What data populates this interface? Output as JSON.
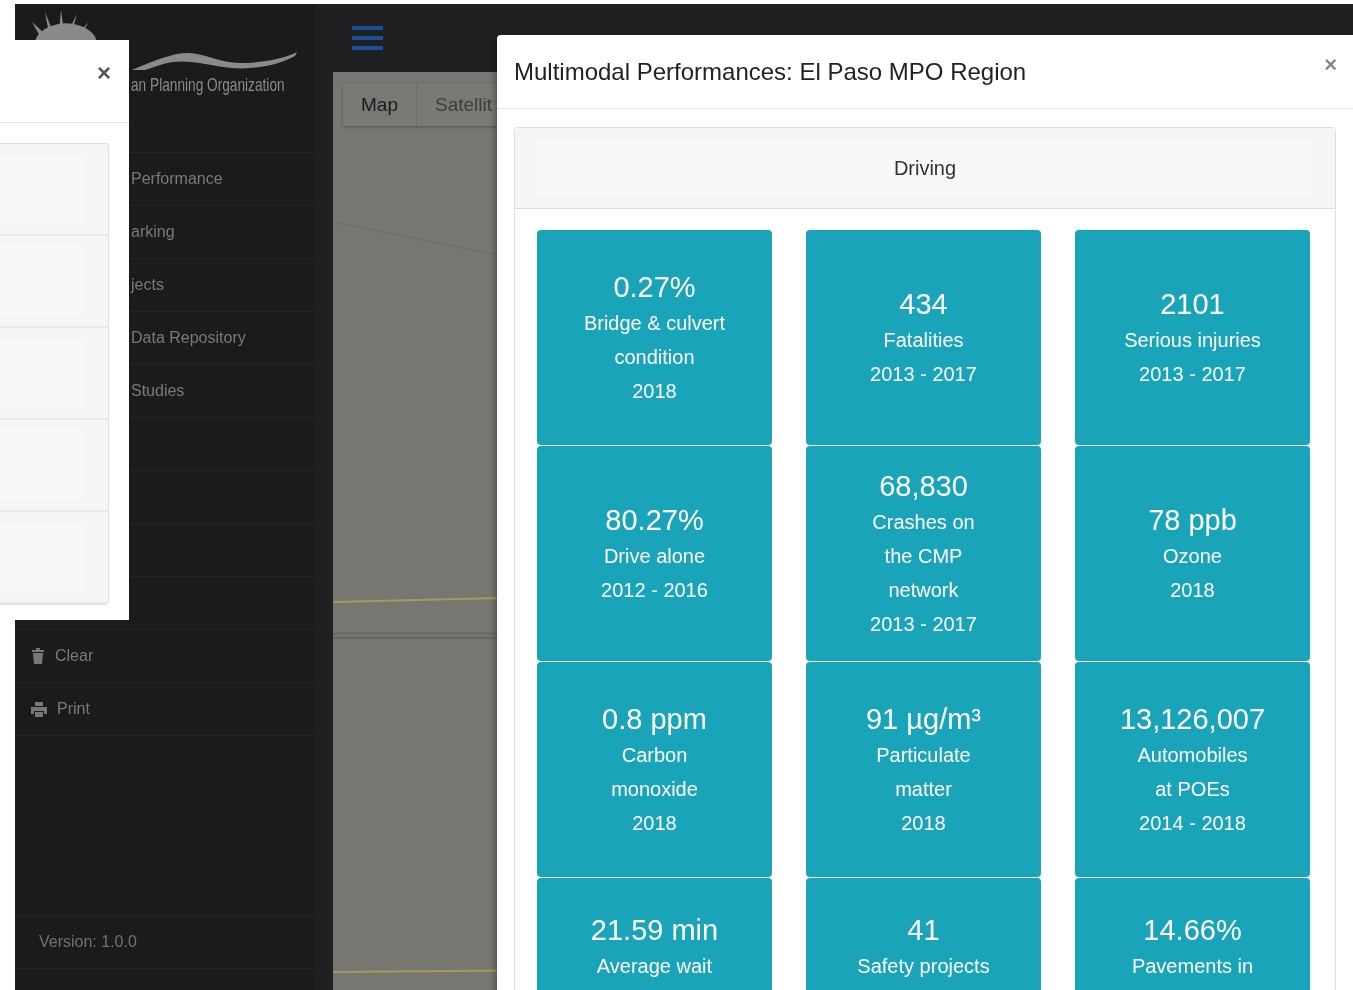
{
  "logo": {
    "text": "an Planning Organization"
  },
  "sidebar": {
    "items": [
      {
        "kind": "link",
        "label": "Performance"
      },
      {
        "kind": "link",
        "label": "arking"
      },
      {
        "kind": "link",
        "label": "jects"
      },
      {
        "kind": "link",
        "label": "Data Repository"
      },
      {
        "kind": "link",
        "label": "Studies"
      }
    ],
    "actions": [
      {
        "kind": "trash",
        "label": "Clear"
      },
      {
        "kind": "print",
        "label": "Print"
      }
    ],
    "version": "Version: 1.0.0"
  },
  "map": {
    "tabs": [
      {
        "label": "Map",
        "selected": true
      },
      {
        "label": "Satellit",
        "selected": false
      }
    ]
  },
  "left_dialog": {
    "close": "×"
  },
  "dialog": {
    "title": "Multimodal Performances: El Paso MPO Region",
    "close": "×",
    "section": "Driving",
    "tiles": [
      {
        "value": "0.27%",
        "label": [
          "Bridge & culvert",
          "condition"
        ],
        "period": "2018"
      },
      {
        "value": "434",
        "label": [
          "Fatalities"
        ],
        "period": "2013 - 2017"
      },
      {
        "value": "2101",
        "label": [
          "Serious injuries"
        ],
        "period": "2013 - 2017"
      },
      {
        "value": "80.27%",
        "label": [
          "Drive alone"
        ],
        "period": "2012 - 2016"
      },
      {
        "value": "68,830",
        "label": [
          "Crashes on",
          "the CMP",
          "network"
        ],
        "period": "2013 - 2017"
      },
      {
        "value": "78 ppb",
        "label": [
          "Ozone"
        ],
        "period": "2018"
      },
      {
        "value": "0.8 ppm",
        "label": [
          "Carbon",
          "monoxide"
        ],
        "period": "2018"
      },
      {
        "value": "91 µg/m³",
        "label": [
          "Particulate",
          "matter"
        ],
        "period": "2018"
      },
      {
        "value": "13,126,007",
        "label": [
          "Automobiles",
          "at POEs"
        ],
        "period": "2014 - 2018"
      },
      {
        "value": "21.59 min",
        "label": [
          "Average wait"
        ]
      },
      {
        "value": "41",
        "label": [
          "Safety projects"
        ]
      },
      {
        "value": "14.66%",
        "label": [
          "Pavements in"
        ]
      }
    ]
  }
}
